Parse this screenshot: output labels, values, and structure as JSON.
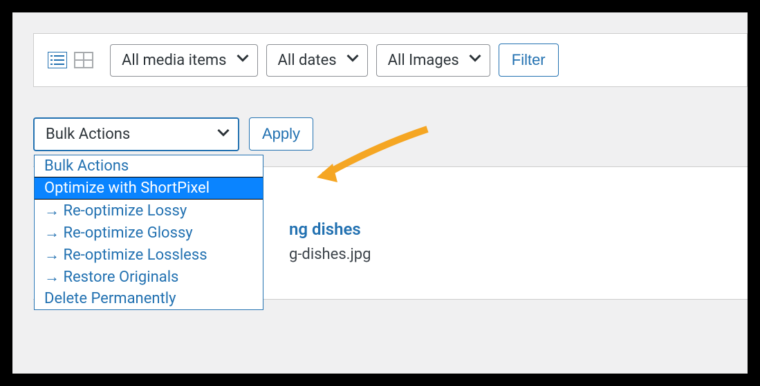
{
  "toolbar": {
    "media_filter": "All media items",
    "date_filter": "All dates",
    "image_filter": "All Images",
    "filter_btn": "Filter"
  },
  "bulk": {
    "label": "Bulk Actions",
    "apply": "Apply",
    "options": [
      "Bulk Actions",
      "Optimize with ShortPixel",
      "→ Re-optimize Lossy",
      "→ Re-optimize Glossy",
      "→ Re-optimize Lossless",
      "→ Restore Originals",
      "Delete Permanently"
    ],
    "highlighted_index": 1
  },
  "item": {
    "title_suffix": "ng dishes",
    "file_suffix": "g-dishes.jpg"
  }
}
